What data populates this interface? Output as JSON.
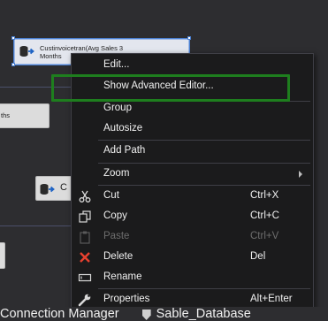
{
  "designer": {
    "selected_task": {
      "line1": "Custinvoicetran(Avg Sales 3",
      "line2": "Months"
    },
    "task_partial_label": "ths",
    "task_partial_letter": "C"
  },
  "context_menu": {
    "edit": "Edit...",
    "show_advanced_editor": "Show Advanced Editor...",
    "group": "Group",
    "autosize": "Autosize",
    "add_path": "Add Path",
    "zoom": "Zoom",
    "cut": {
      "label": "Cut",
      "shortcut": "Ctrl+X"
    },
    "copy": {
      "label": "Copy",
      "shortcut": "Ctrl+C"
    },
    "paste": {
      "label": "Paste",
      "shortcut": "Ctrl+V"
    },
    "delete": {
      "label": "Delete",
      "shortcut": "Del"
    },
    "rename": "Rename",
    "properties": {
      "label": "Properties",
      "shortcut": "Alt+Enter"
    }
  },
  "bottom_tabs": {
    "connection_manager": "Connection Manager",
    "sable_database": "Sable_Database"
  },
  "colors": {
    "canvas": "#2d2d30",
    "menu_background": "#1b1b1c",
    "highlight_box": "#1e7e1e",
    "selection_border": "#4a7fd0"
  }
}
